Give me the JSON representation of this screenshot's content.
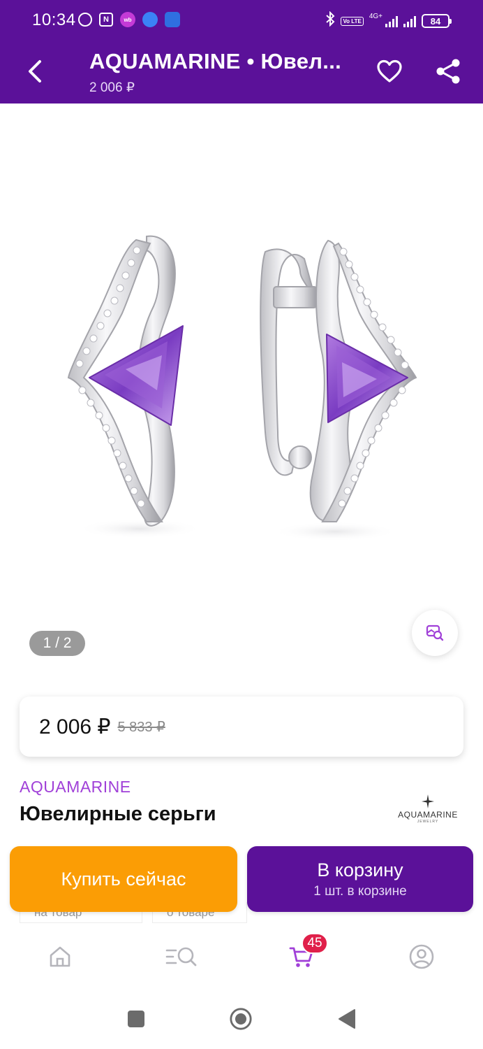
{
  "status_bar": {
    "time": "10:34",
    "network_label": "4G+",
    "battery": "84",
    "volte_label": "Vo LTE"
  },
  "header": {
    "title": "AQUAMARINE • Ювел...",
    "price": "2 006 ₽"
  },
  "gallery": {
    "counter": "1 / 2"
  },
  "price": {
    "current": "2 006 ₽",
    "old": "5 833 ₽"
  },
  "product": {
    "brand": "AQUAMARINE",
    "title": "Ювелирные серьги",
    "logo_text": "AQUAMARINE",
    "logo_sub": "JEWELRY"
  },
  "peek_tabs": [
    "на товар",
    "о товаре"
  ],
  "actions": {
    "buy_now": "Купить сейчас",
    "add_to_cart": "В корзину",
    "in_cart": "1 шт. в корзине"
  },
  "bottom_nav": {
    "cart_count": "45"
  },
  "colors": {
    "brand_purple": "#5b1199",
    "accent_orange": "#fb9d05",
    "badge_red": "#e0204a",
    "brand_text": "#a040d8"
  }
}
